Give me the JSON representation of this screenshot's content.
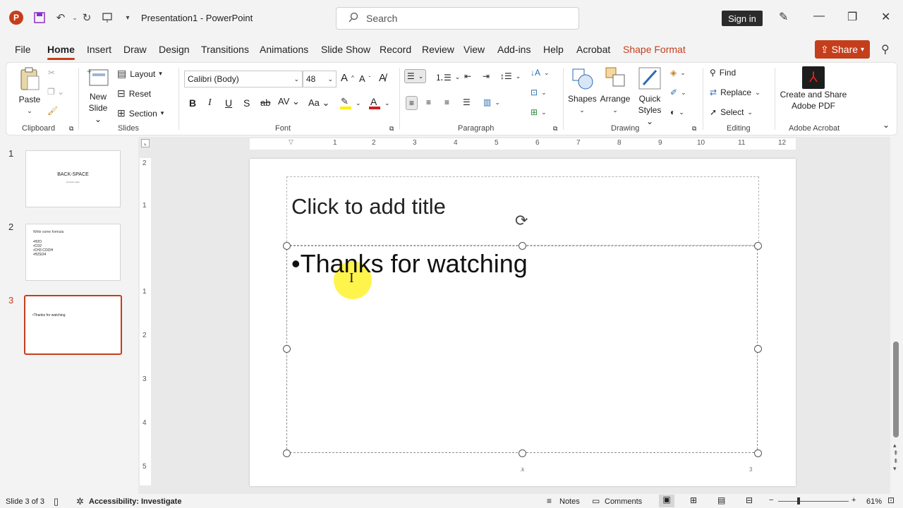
{
  "app": {
    "title": "Presentation1  -  PowerPoint",
    "search_placeholder": "Search",
    "sign_in": "Sign in"
  },
  "tabs": [
    "File",
    "Home",
    "Insert",
    "Draw",
    "Design",
    "Transitions",
    "Animations",
    "Slide Show",
    "Record",
    "Review",
    "View",
    "Add-ins",
    "Help",
    "Acrobat",
    "Shape Format"
  ],
  "share_label": "Share",
  "ribbon": {
    "clipboard": {
      "paste": "Paste",
      "label": "Clipboard"
    },
    "slides": {
      "new_slide_1": "New",
      "new_slide_2": "Slide",
      "layout": "Layout",
      "reset": "Reset",
      "section": "Section",
      "label": "Slides"
    },
    "font": {
      "font_name": "Calibri (Body)",
      "font_size": "48",
      "label": "Font"
    },
    "paragraph": {
      "label": "Paragraph"
    },
    "drawing": {
      "shapes": "Shapes",
      "arrange": "Arrange",
      "quick_1": "Quick",
      "quick_2": "Styles",
      "label": "Drawing"
    },
    "editing": {
      "find": "Find",
      "replace": "Replace",
      "select": "Select",
      "label": "Editing"
    },
    "acrobat": {
      "line1": "Create and Share",
      "line2": "Adobe PDF",
      "label": "Adobe Acrobat"
    }
  },
  "thumbnails": [
    {
      "num": "1",
      "title": "BACK-SPACE",
      "sub": "Exclude sales"
    },
    {
      "num": "2",
      "title": "Write some formula",
      "items": [
        "•H2O",
        "•CO2",
        "•CH3 COOH",
        "•H2SO4"
      ]
    },
    {
      "num": "3",
      "title": "•Thanks for watching"
    }
  ],
  "slide": {
    "title_placeholder": "Click to add title",
    "body_text": "•Thanks for watching",
    "footer_mid": ".k",
    "footer_right": "3"
  },
  "ruler_h": [
    "1",
    "1",
    "2",
    "3",
    "4",
    "5",
    "6",
    "7",
    "8",
    "9",
    "10",
    "11",
    "12"
  ],
  "ruler_v": [
    "2",
    "1",
    "1",
    "2",
    "3",
    "4",
    "5"
  ],
  "status": {
    "slide_info": "Slide 3 of 3",
    "accessibility": "Accessibility: Investigate",
    "notes": "Notes",
    "comments": "Comments",
    "zoom": "61%"
  }
}
